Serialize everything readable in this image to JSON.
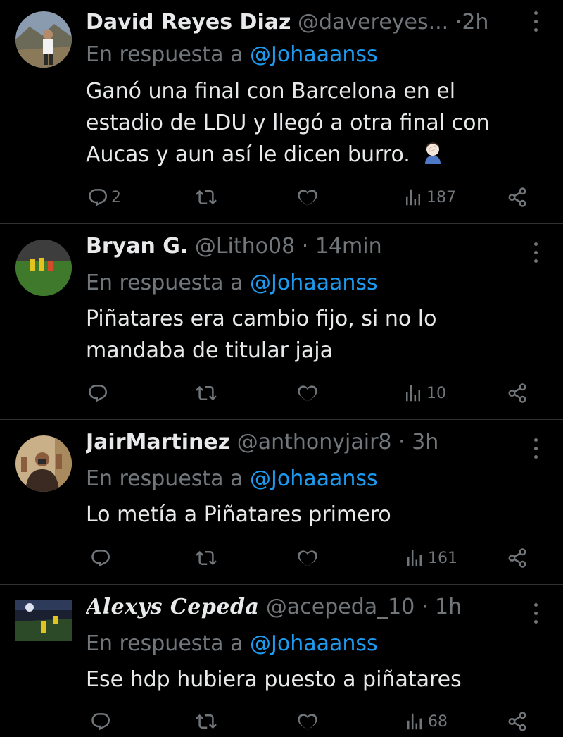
{
  "tweets": [
    {
      "name": "David Reyes Diaz",
      "handle": "@davereyes...",
      "separator": "·",
      "time": "2h",
      "reply_prefix": "En respuesta a",
      "reply_to": "@Johaaanss",
      "text": "Ganó una final con Barcelona en el estadio de LDU y llegó a otra final con Aucas y aun así le dicen burro.",
      "replies": "2",
      "retweets": "",
      "likes": "",
      "views": "187"
    },
    {
      "name": "Bryan G.",
      "handle": "@Litho08",
      "separator": "·",
      "time": "14min",
      "reply_prefix": "En respuesta a",
      "reply_to": "@Johaaanss",
      "text": "Piñatares era cambio fijo, si no lo mandaba de titular jaja",
      "replies": "",
      "retweets": "",
      "likes": "",
      "views": "10"
    },
    {
      "name": "JairMartinez",
      "handle": "@anthonyjair8",
      "separator": "·",
      "time": "3h",
      "reply_prefix": "En respuesta a",
      "reply_to": "@Johaaanss",
      "text": "Lo metía a Piñatares primero",
      "replies": "",
      "retweets": "",
      "likes": "",
      "views": "161"
    },
    {
      "name": "Alexys Cepeda",
      "handle": "@acepeda_10",
      "separator": "·",
      "time": "1h",
      "reply_prefix": "En respuesta a",
      "reply_to": "@Johaaanss",
      "text": "Ese hdp hubiera puesto a piñatares",
      "replies": "",
      "retweets": "",
      "likes": "",
      "views": "68"
    }
  ],
  "icons": {
    "reply": "reply-icon",
    "retweet": "retweet-icon",
    "like": "heart-icon",
    "views": "views-icon",
    "share": "share-icon",
    "more": "more-icon",
    "emoji": "face-palm-emoji"
  },
  "colors": {
    "background": "#000000",
    "text": "#e7e9ea",
    "secondary": "#71767b",
    "link": "#1d9bf0",
    "divider": "#2f3336"
  }
}
